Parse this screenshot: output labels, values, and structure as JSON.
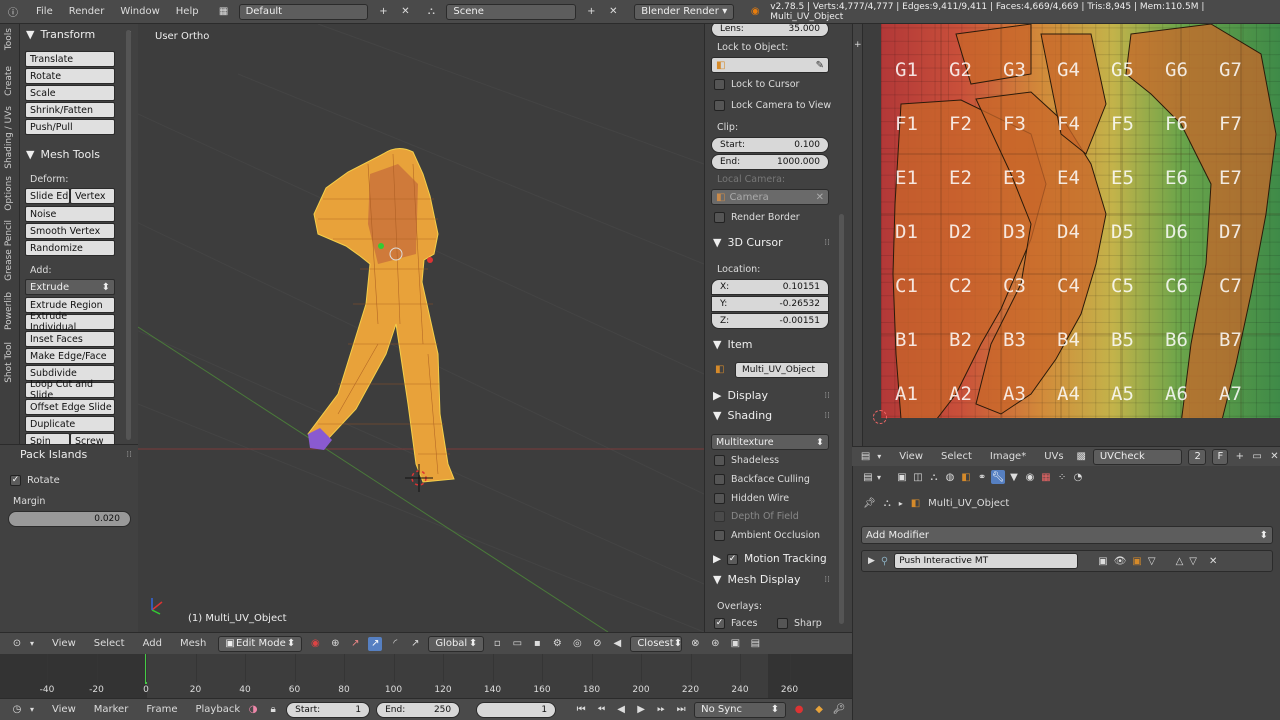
{
  "topbar": {
    "menus": [
      "File",
      "Render",
      "Window",
      "Help"
    ],
    "layout": "Default",
    "scene": "Scene",
    "engine": "Blender Render",
    "stats": "v2.78.5 | Verts:4,777/4,777 | Edges:9,411/9,411 | Faces:4,669/4,669 | Tris:8,945 | Mem:110.5M | Multi_UV_Object"
  },
  "tool_tabs": [
    "Tools",
    "Create",
    "Shading / UVs",
    "Options",
    "Grease Pencil",
    "Powerlib",
    "Shot Tool"
  ],
  "toolshelf": {
    "transform_title": "Transform",
    "transform": [
      "Translate",
      "Rotate",
      "Scale",
      "Shrink/Fatten",
      "Push/Pull"
    ],
    "mesh_tools_title": "Mesh Tools",
    "deform_label": "Deform:",
    "slide_edge": "Slide Ed",
    "vertex": "Vertex",
    "deform": [
      "Noise",
      "Smooth Vertex",
      "Randomize"
    ],
    "add_label": "Add:",
    "extrude": "Extrude",
    "add": [
      "Extrude Region",
      "Extrude Individual",
      "Inset Faces",
      "Make Edge/Face",
      "Subdivide",
      "Loop Cut and Slide",
      "Offset Edge Slide",
      "Duplicate"
    ],
    "spin": "Spin",
    "screw": "Screw"
  },
  "operator": {
    "title": "Pack Islands",
    "rotate": "Rotate",
    "margin_label": "Margin",
    "margin_value": "0.020"
  },
  "viewport": {
    "view_name": "User Ortho",
    "object_label": "(1) Multi_UV_Object"
  },
  "properties": {
    "lens_label": "Lens:",
    "lens_value": "35.000",
    "lock_object_label": "Lock to Object:",
    "lock_cursor": "Lock to Cursor",
    "lock_camera": "Lock Camera to View",
    "clip_label": "Clip:",
    "clip_start_label": "Start:",
    "clip_start": "0.100",
    "clip_end_label": "End:",
    "clip_end": "1000.000",
    "local_camera_label": "Local Camera:",
    "camera": "Camera",
    "render_border": "Render Border",
    "cursor_title": "3D Cursor",
    "location_label": "Location:",
    "x_label": "X:",
    "x": "0.10151",
    "y_label": "Y:",
    "y": "-0.26532",
    "z_label": "Z:",
    "z": "-0.00151",
    "item_title": "Item",
    "item_name": "Multi_UV_Object",
    "display_title": "Display",
    "shading_title": "Shading",
    "shading_mode": "Multitexture",
    "shadeless": "Shadeless",
    "backface": "Backface Culling",
    "hidden_wire": "Hidden Wire",
    "depth_of_field": "Depth Of Field",
    "ambient_occlusion": "Ambient Occlusion",
    "motion_tracking": "Motion Tracking",
    "mesh_display_title": "Mesh Display",
    "overlays_label": "Overlays:",
    "faces": "Faces",
    "sharp": "Sharp"
  },
  "viewport_header": {
    "menus": [
      "View",
      "Select",
      "Add",
      "Mesh"
    ],
    "mode": "Edit Mode",
    "orientation": "Global",
    "snap": "Closest"
  },
  "timeline": {
    "ticks": [
      "-40",
      "-20",
      "0",
      "20",
      "40",
      "60",
      "80",
      "100",
      "120",
      "140",
      "160",
      "180",
      "200",
      "220",
      "240",
      "260"
    ],
    "current_frame": 0,
    "menus": [
      "View",
      "Marker",
      "Frame",
      "Playback"
    ],
    "start_label": "Start:",
    "start": "1",
    "end_label": "End:",
    "end": "250",
    "frame": "1",
    "sync": "No Sync"
  },
  "uv_editor": {
    "grid_labels": [
      [
        "G1",
        "G2",
        "G3",
        "G4",
        "G5",
        "G6",
        "G7"
      ],
      [
        "F1",
        "F2",
        "F3",
        "F4",
        "F5",
        "F6",
        "F7"
      ],
      [
        "E1",
        "E2",
        "E3",
        "E4",
        "E5",
        "E6",
        "E7"
      ],
      [
        "D1",
        "D2",
        "D3",
        "D4",
        "D5",
        "D6",
        "D7"
      ],
      [
        "C1",
        "C2",
        "C3",
        "C4",
        "C5",
        "C6",
        "C7"
      ],
      [
        "B1",
        "B2",
        "B3",
        "B4",
        "B5",
        "B6",
        "B7"
      ],
      [
        "A1",
        "A2",
        "A3",
        "A4",
        "A5",
        "A6",
        "A7"
      ]
    ],
    "menus": [
      "View",
      "Select",
      "Image*",
      "UVs"
    ],
    "image_name": "UVCheck",
    "users": "2",
    "fake": "F"
  },
  "modifiers": {
    "object_name": "Multi_UV_Object",
    "add_modifier": "Add Modifier",
    "modifier_name": "Push Interactive MT"
  }
}
